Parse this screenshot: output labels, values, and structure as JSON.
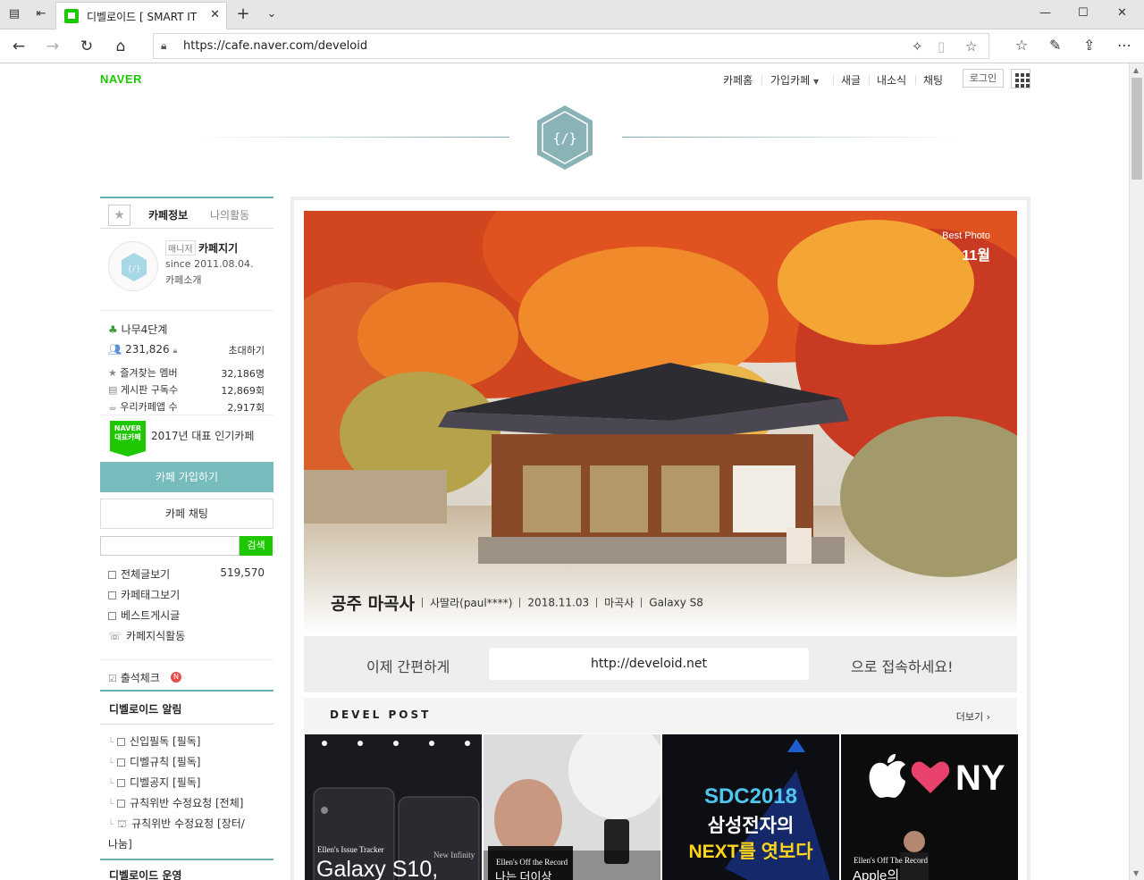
{
  "browser": {
    "tab_title": "디벨로이드 [ SMART IT",
    "url": "https://cafe.naver.com/develoid"
  },
  "gnb": {
    "brand": "NAVER",
    "items": [
      "카페홈",
      "가입카페",
      "새글",
      "내소식",
      "채팅"
    ],
    "login": "로그인"
  },
  "sidebar": {
    "tabs": [
      "카페정보",
      "나의활동"
    ],
    "manager_tag": "매니저",
    "manager_name": "카페지기",
    "since": "since 2011.08.04.",
    "intro": "카페소개",
    "level": "나무4단계",
    "members": "231,826",
    "invite": "초대하기",
    "stats": [
      {
        "label": "즐겨찾는 멤버",
        "value": "32,186명"
      },
      {
        "label": "게시판 구독수",
        "value": "12,869회"
      },
      {
        "label": "우리카페앱 수",
        "value": "2,917회"
      }
    ],
    "badge_line1": "NAVER",
    "badge_line2": "대표카페",
    "award": "2017년 대표 인기카페",
    "join": "카페 가입하기",
    "chat": "카페 채팅",
    "search_btn": "검색",
    "menu": [
      {
        "label": "전체글보기",
        "count": "519,570"
      },
      {
        "label": "카페태그보기"
      },
      {
        "label": "베스트게시글"
      },
      {
        "label": "카페지식활동"
      }
    ],
    "attend": "출석체크",
    "attend_badge": "N",
    "notice_title": "디벨로이드 알림",
    "notice_items": [
      "신입필독 [필독]",
      "디벨규칙 [필독]",
      "디벨공지 [필독]",
      "규칙위반 수정요청 [전체]",
      "규칙위반 수정요청 [장터/",
      "나눔]"
    ],
    "ops_title": "디벨로이드 운영"
  },
  "main": {
    "best_photo": "Best Photo",
    "month": "11월",
    "caption_title": "공주 마곡사",
    "caption_meta": [
      "사딸라(paul****)",
      "2018.11.03",
      "마곡사",
      "Galaxy S8"
    ],
    "url_left": "이제 간편하게",
    "url_mid": "http://develoid.net",
    "url_right": "으로 접속하세요!",
    "post_title": "DEVEL POST",
    "post_more": "더보기 ›",
    "thumbs": [
      {
        "tag": "Ellen's Issue Tracker",
        "tag2": "New Infinity",
        "title": "Galaxy S10,"
      },
      {
        "tag": "Ellen's Off the Record",
        "title": "나는 더이상"
      },
      {
        "line1": "SDC2018",
        "line2": "삼성전자의",
        "line3": "NEXT를 엿보다"
      },
      {
        "logo": "NY",
        "tag": "Ellen's Off The Record",
        "title": "Apple의"
      }
    ]
  },
  "colors": {
    "naver_green": "#1ec800",
    "teal": "#77bcbc"
  }
}
